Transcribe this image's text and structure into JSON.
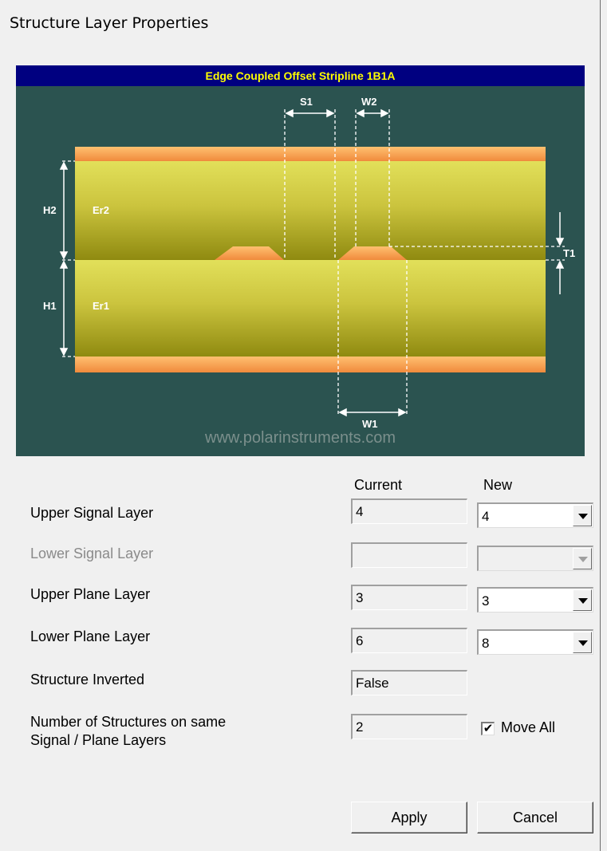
{
  "window": {
    "title": "Structure Layer Properties"
  },
  "diagram": {
    "title": "Edge Coupled Offset Stripline 1B1A",
    "labels": {
      "s1": "S1",
      "w2": "W2",
      "h2": "H2",
      "er2": "Er2",
      "t1": "T1",
      "h1": "H1",
      "er1": "Er1",
      "w1": "W1"
    },
    "watermark": "www.polarinstruments.com"
  },
  "columns": {
    "current": "Current",
    "new": "New"
  },
  "rows": {
    "upper_signal": {
      "label": "Upper Signal Layer",
      "current": "4",
      "new": "4"
    },
    "lower_signal": {
      "label": "Lower Signal Layer",
      "current": "",
      "new": ""
    },
    "upper_plane": {
      "label": "Upper Plane Layer",
      "current": "3",
      "new": "3"
    },
    "lower_plane": {
      "label": "Lower Plane Layer",
      "current": "6",
      "new": "8"
    },
    "inverted": {
      "label": "Structure Inverted",
      "current": "False"
    },
    "count": {
      "label_line1": "Number of Structures on same",
      "label_line2": "Signal / Plane Layers",
      "current": "2"
    }
  },
  "move_all": {
    "label": "Move All",
    "checked": true,
    "mark": "✔"
  },
  "buttons": {
    "apply": "Apply",
    "cancel": "Cancel"
  }
}
